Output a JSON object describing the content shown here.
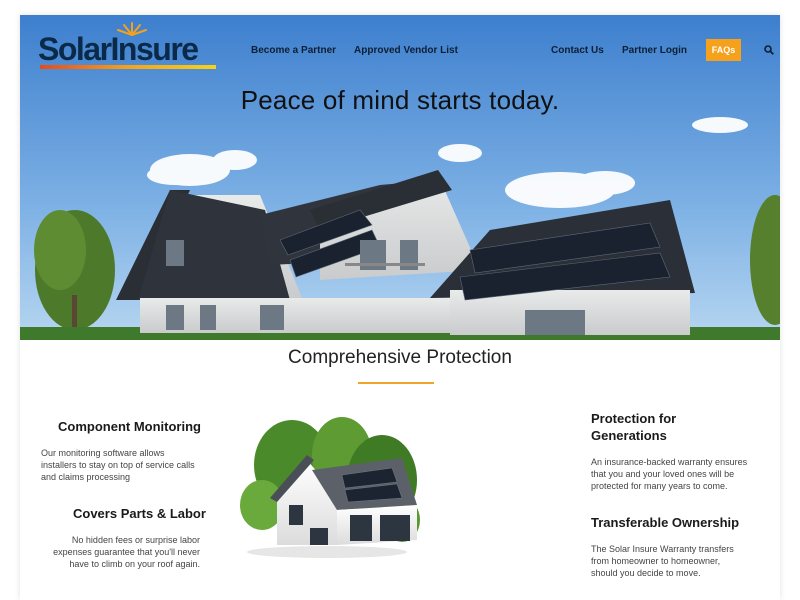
{
  "brand": {
    "logo_text": "SolarInsure"
  },
  "nav": {
    "left_links": [
      "Become a Partner",
      "Approved Vendor List"
    ],
    "right_links": [
      "Contact Us",
      "Partner Login"
    ],
    "faq_label": "FAQs",
    "search_icon": "search-icon",
    "faq_color": "#f5a11c"
  },
  "hero": {
    "headline": "Peace of mind starts today."
  },
  "section": {
    "title": "Comprehensive Protection",
    "accent_color": "#f0a52a"
  },
  "features": {
    "left": [
      {
        "title": "Component Monitoring",
        "desc": [
          "Our monitoring software allows",
          "installers to stay on top of service calls",
          "and claims processing"
        ]
      },
      {
        "title": "Covers Parts & Labor",
        "desc": [
          "No hidden fees or surprise labor",
          "expenses guarantee that you'll never",
          "have to climb on your roof again."
        ]
      }
    ],
    "right": [
      {
        "title": [
          "Protection for",
          "Generations"
        ],
        "desc": [
          "An insurance-backed warranty ensures",
          "that you and your loved ones will be",
          "protected for many years to come."
        ]
      },
      {
        "title": [
          "Transferable Ownership"
        ],
        "desc": [
          "The Solar Insure Warranty transfers",
          "from homeowner to homeowner,",
          "should you decide to move."
        ]
      }
    ]
  }
}
